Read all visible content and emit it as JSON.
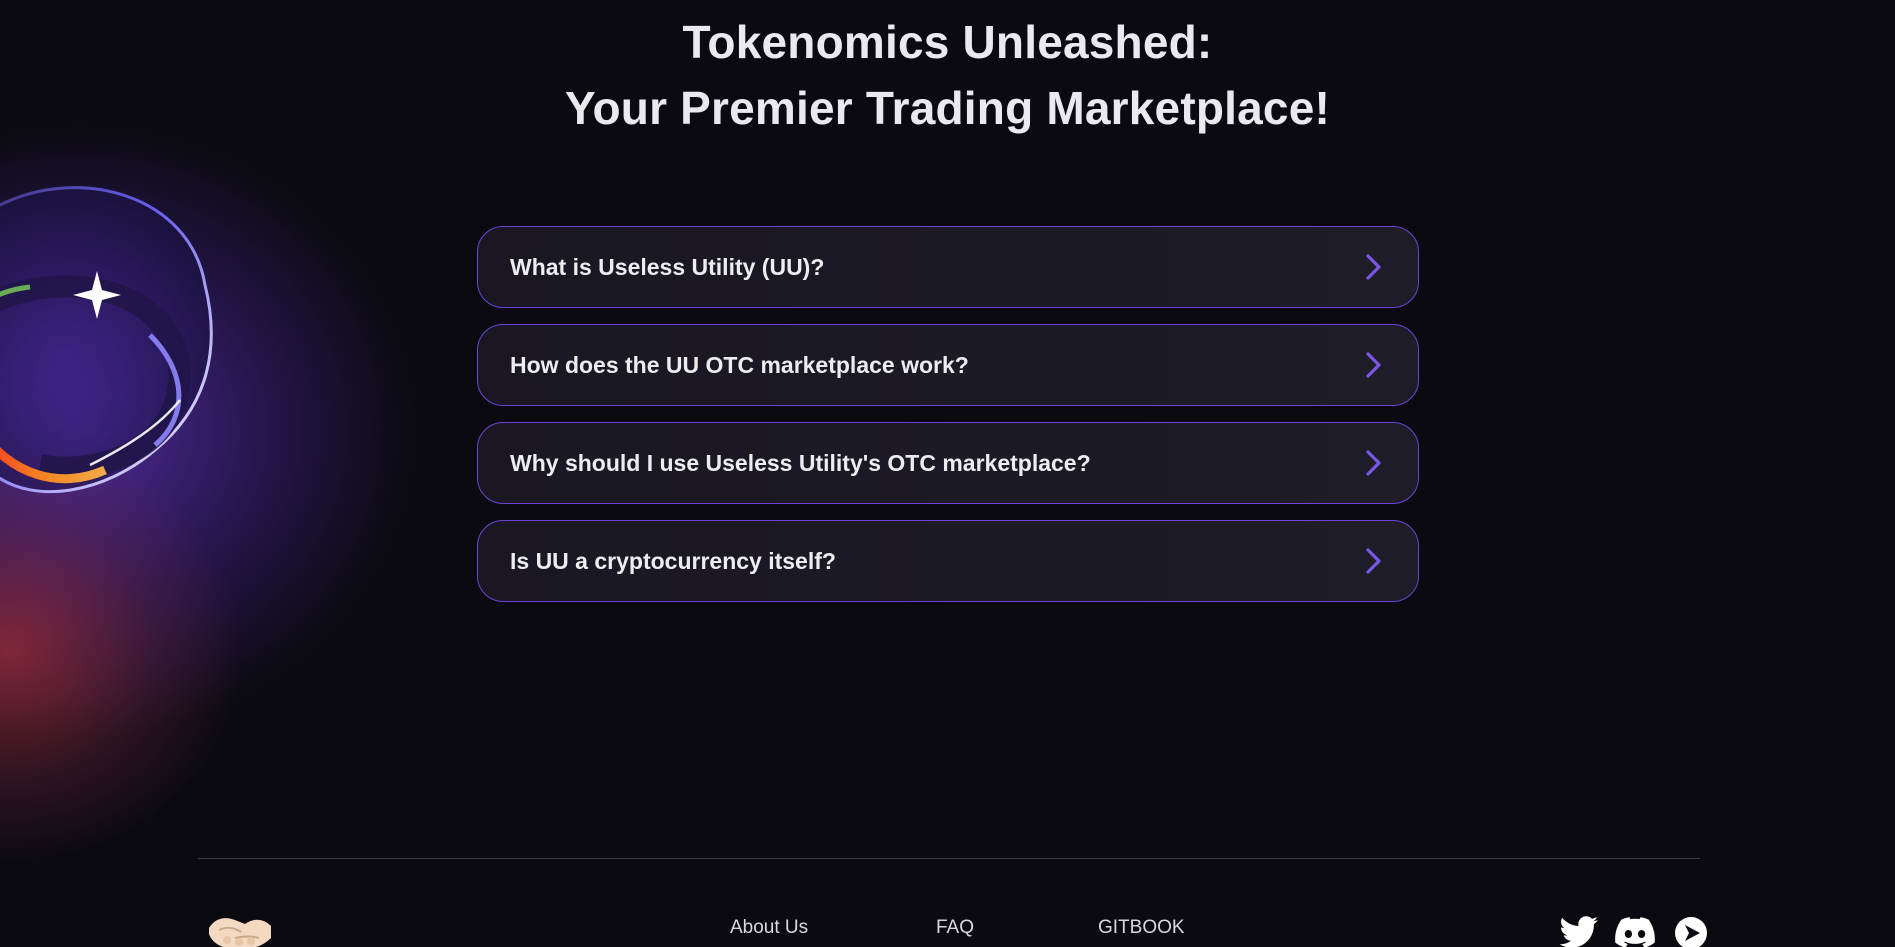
{
  "hero": {
    "title_line1": "Tokenomics Unleashed:",
    "title_line2": "Your Premier Trading Marketplace!"
  },
  "faq": {
    "items": [
      {
        "question": "What is Useless Utility (UU)?"
      },
      {
        "question": "How does the UU OTC marketplace work?"
      },
      {
        "question": "Why should I use Useless Utility's OTC marketplace?"
      },
      {
        "question": "Is UU a cryptocurrency itself?"
      }
    ],
    "chevron_icon": "chevron-right-icon",
    "accent_color": "#6b43d6"
  },
  "footer": {
    "logo_icon": "handshake-icon",
    "links": [
      {
        "label": "About Us"
      },
      {
        "label": "FAQ"
      },
      {
        "label": "GITBOOK"
      }
    ],
    "socials": [
      {
        "icon": "twitter-icon"
      },
      {
        "icon": "discord-icon"
      },
      {
        "icon": "play-icon"
      }
    ]
  }
}
